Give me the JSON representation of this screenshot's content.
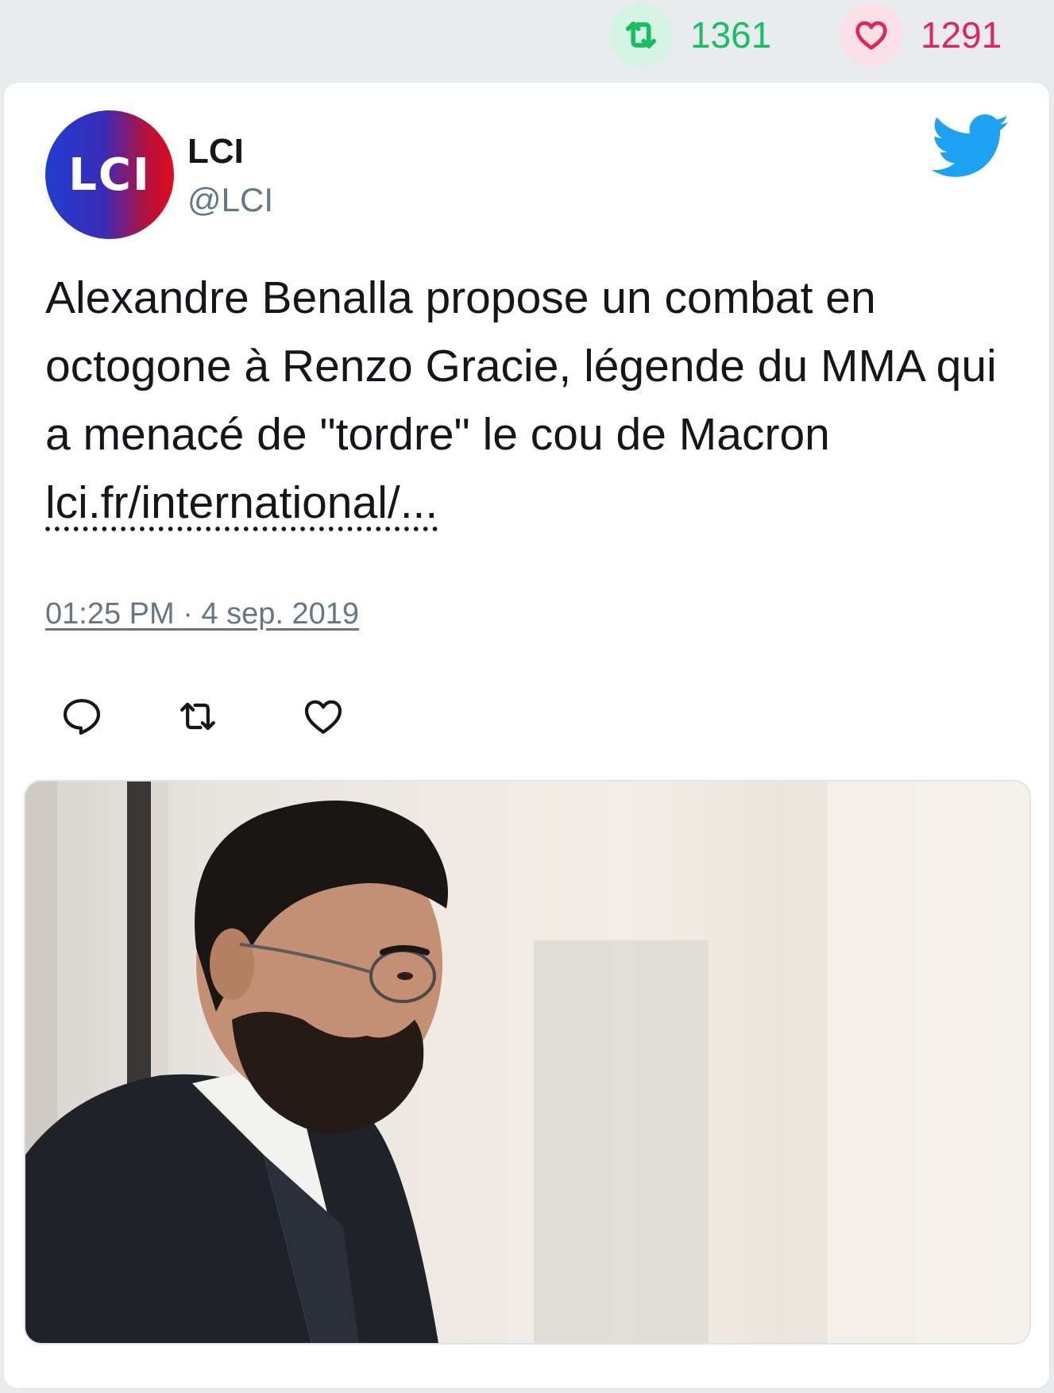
{
  "stats": {
    "retweets": "1361",
    "likes": "1291",
    "retweet_color": "#17bf63",
    "like_color": "#e0245e"
  },
  "tweet": {
    "avatar_text": "LCI",
    "name": "LCI",
    "handle": "@LCI",
    "text": "Alexandre Benalla propose un combat en octogone à Renzo Gracie, légende du MMA qui a menacé de \"tordre\" le cou de Macron ",
    "link": "lci.fr/international/...",
    "timestamp": "01:25 PM · 4 sep. 2019",
    "brand_icon": "twitter-bird-icon",
    "actions": [
      "reply-icon",
      "retweet-icon",
      "like-icon"
    ]
  },
  "colors": {
    "twitter_blue": "#1da1f2",
    "secondary_text": "#657786"
  }
}
